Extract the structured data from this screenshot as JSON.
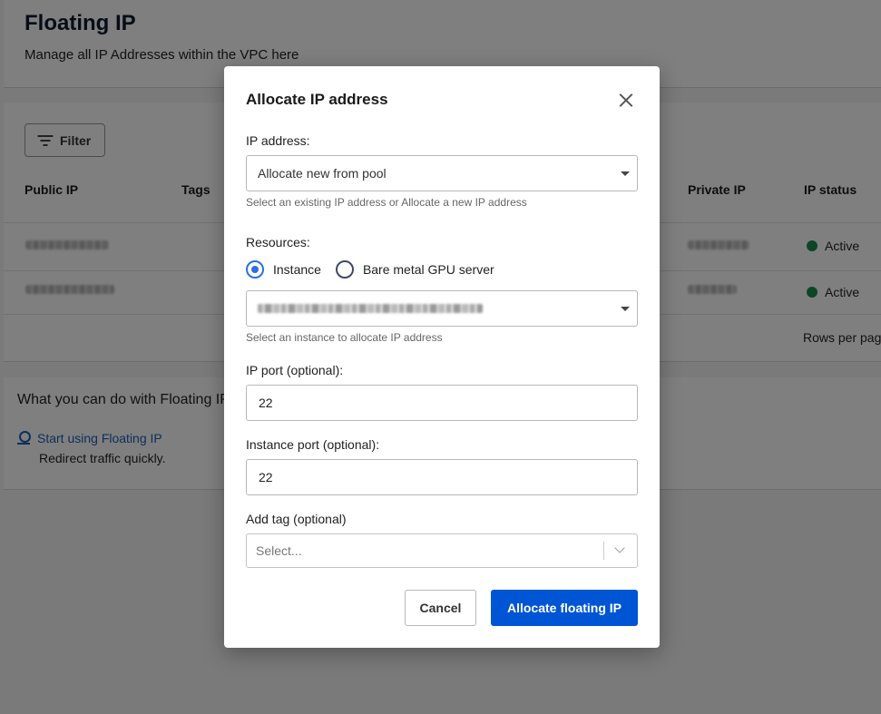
{
  "page": {
    "title": "Floating IP",
    "subtitle": "Manage all IP Addresses within the VPC here",
    "filter_label": "Filter",
    "table": {
      "columns": [
        "Public IP",
        "Tags",
        "Private IP",
        "IP status"
      ],
      "rows": [
        {
          "status": "Active"
        },
        {
          "status": "Active"
        }
      ],
      "rows_per_page_label": "Rows per pag"
    },
    "help": {
      "title": "What you can do with Floating IP",
      "link_label": "Start using Floating IP",
      "link_desc": "Redirect traffic quickly."
    },
    "colors": {
      "status_active": "#1b8a4f",
      "link": "#1a5fb4"
    }
  },
  "modal": {
    "title": "Allocate IP address",
    "ip_address": {
      "label": "IP address:",
      "selected": "Allocate new from pool",
      "helper": "Select an existing IP address or Allocate a new IP address"
    },
    "resources": {
      "label": "Resources:",
      "options": [
        {
          "label": "Instance",
          "checked": true
        },
        {
          "label": "Bare metal GPU server",
          "checked": false
        }
      ],
      "helper": "Select an instance to allocate IP address"
    },
    "ip_port": {
      "label": "IP port (optional):",
      "value": "22"
    },
    "instance_port": {
      "label": "Instance port (optional):",
      "value": "22"
    },
    "tag": {
      "label": "Add tag (optional)",
      "placeholder": "Select..."
    },
    "cancel_label": "Cancel",
    "primary_label": "Allocate floating IP",
    "colors": {
      "primary": "#0055d4",
      "radio_checked": "#2f6fe0"
    }
  }
}
